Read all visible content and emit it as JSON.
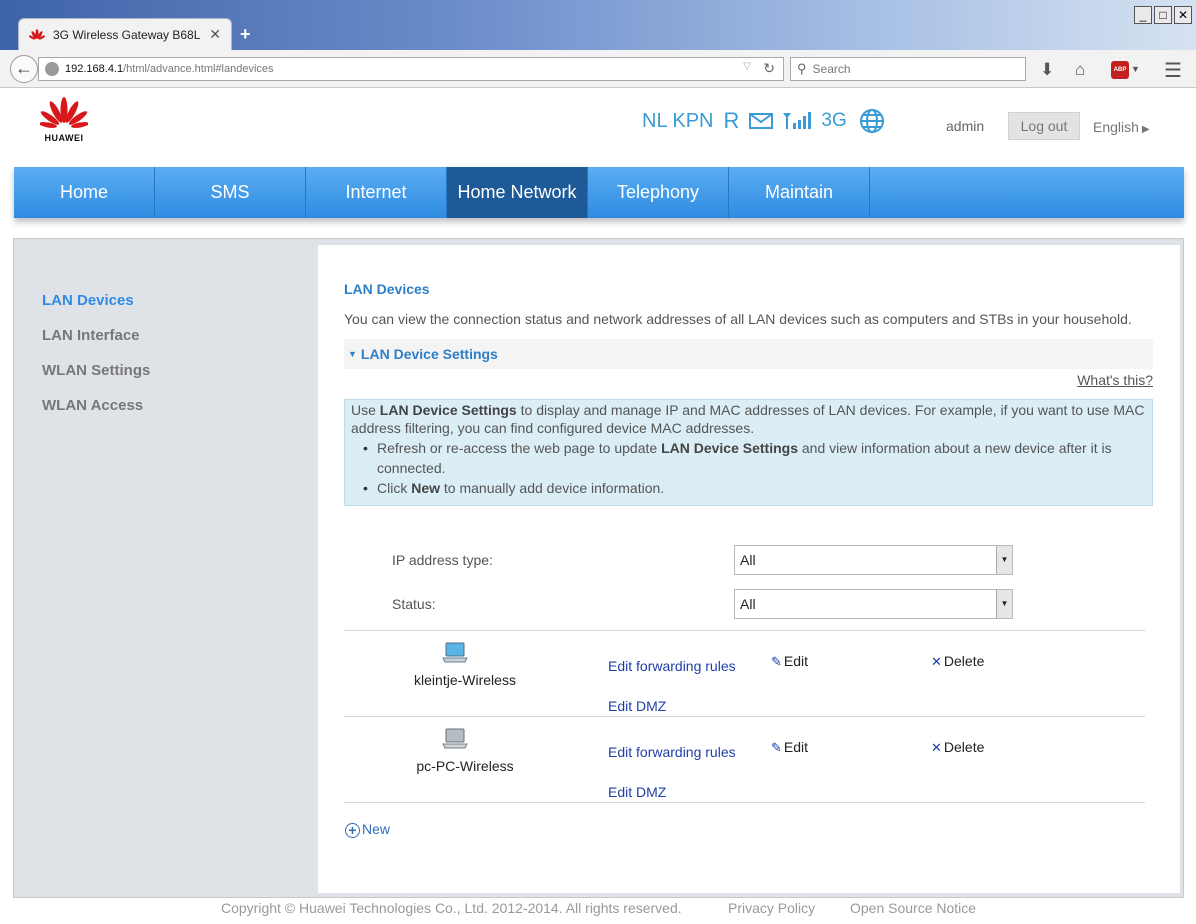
{
  "browser": {
    "tab_title": "3G Wireless Gateway B68L",
    "url_host": "192.168.4.1",
    "url_path": "/html/advance.html#landevices",
    "search_placeholder": "Search"
  },
  "header": {
    "brand": "HUAWEI",
    "operator": "NL KPN",
    "roaming": "R",
    "network_type": "3G",
    "user": "admin",
    "logout_label": "Log out",
    "language": "English",
    "accent_color": "#2f8be3"
  },
  "nav": {
    "items": [
      {
        "label": "Home"
      },
      {
        "label": "SMS"
      },
      {
        "label": "Internet"
      },
      {
        "label": "Home Network"
      },
      {
        "label": "Telephony"
      },
      {
        "label": "Maintain"
      }
    ],
    "active": "Home Network"
  },
  "sidebar": {
    "items": [
      {
        "label": "LAN Devices"
      },
      {
        "label": "LAN Interface"
      },
      {
        "label": "WLAN Settings"
      },
      {
        "label": "WLAN Access"
      }
    ],
    "active": "LAN Devices"
  },
  "main": {
    "title": "LAN Devices",
    "description": "You can view the connection status and network addresses of all LAN devices such as computers and STBs in your household.",
    "section_title": "LAN Device Settings",
    "whats_this": "What's this?",
    "help": {
      "p1_pre": "Use ",
      "p1_bold": "LAN Device Settings",
      "p1_post": " to display and manage IP and MAC addresses of LAN devices. For example, if you want to use MAC address filtering, you can find configured device MAC addresses.",
      "b1_pre": "Refresh or re-access the web page to update ",
      "b1_bold": "LAN Device Settings",
      "b1_post": " and view information about a new device after it is connected.",
      "b2_pre": "Click ",
      "b2_bold": "New",
      "b2_post": " to manually add device information."
    },
    "filters": {
      "ip_type_label": "IP address type:",
      "ip_type_value": "All",
      "status_label": "Status:",
      "status_value": "All"
    },
    "devices": [
      {
        "name": "kleintje-Wireless",
        "forwarding": "Edit forwarding rules",
        "dmz": "Edit DMZ",
        "edit": "Edit",
        "delete": "Delete",
        "active": true
      },
      {
        "name": "pc-PC-Wireless",
        "forwarding": "Edit forwarding rules",
        "dmz": "Edit DMZ",
        "edit": "Edit",
        "delete": "Delete",
        "active": false
      }
    ],
    "new_label": "New"
  },
  "footer": {
    "copyright": "Copyright © Huawei Technologies Co., Ltd. 2012-2014. All rights reserved.",
    "privacy": "Privacy Policy",
    "open_source": "Open Source Notice"
  }
}
